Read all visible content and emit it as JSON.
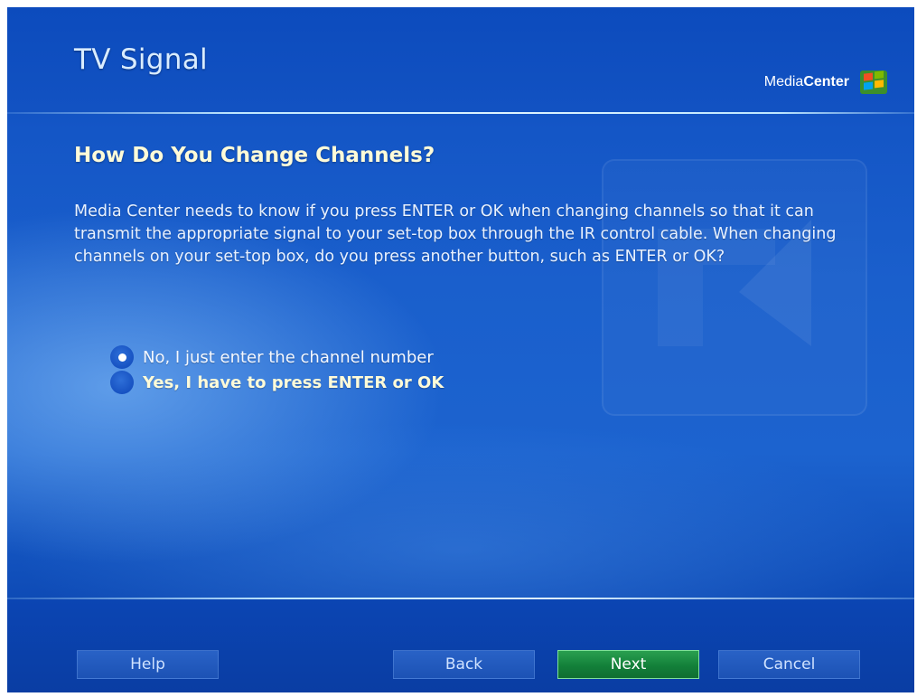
{
  "header": {
    "title": "TV Signal",
    "brand_prefix": "Media",
    "brand_bold": "Center"
  },
  "page": {
    "heading": "How Do You Change Channels?",
    "description": "Media Center needs to know if you press ENTER or OK when changing channels so that it can transmit the appropriate signal to your set-top box through the IR control cable. When changing channels on your set-top box, do you press another button, such as ENTER or OK?"
  },
  "options": [
    {
      "label": "No, I just enter the channel number",
      "selected": true
    },
    {
      "label": "Yes, I have to press ENTER or OK",
      "selected": false
    }
  ],
  "buttons": {
    "help": "Help",
    "back": "Back",
    "next": "Next",
    "cancel": "Cancel"
  },
  "colors": {
    "background": "#1a5fcc",
    "heading": "#fffbd8",
    "primary_button": "#13803a"
  },
  "icons": {
    "brand_logo": "windows-flag-icon",
    "watermark": "arrow-watermark-icon",
    "radio": "radio-button-icon"
  }
}
